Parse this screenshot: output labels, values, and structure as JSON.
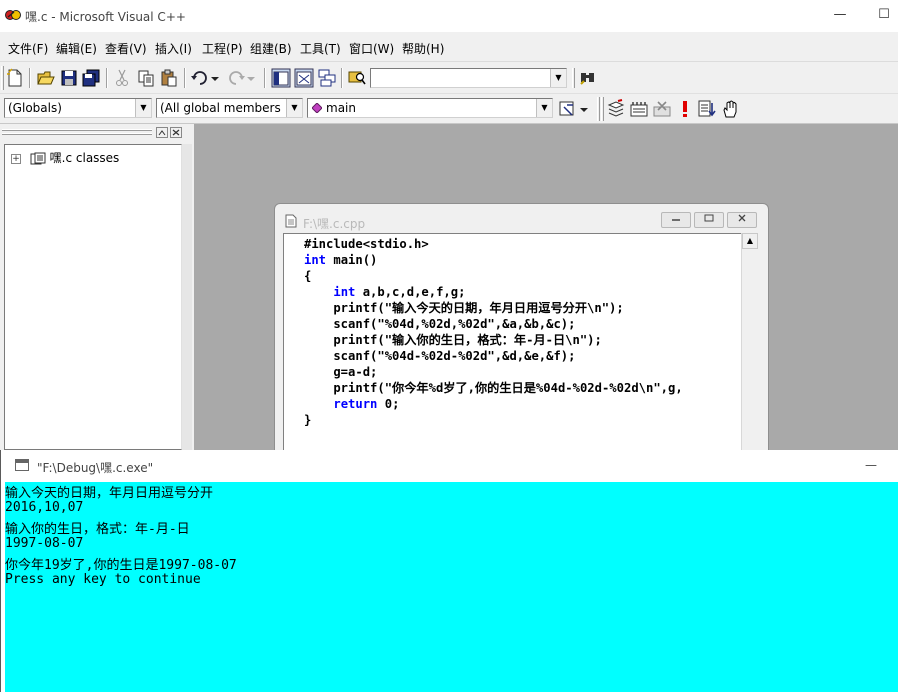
{
  "window": {
    "title": "嘿.c - Microsoft Visual C++",
    "minimize_glyph": "—",
    "maximize_glyph": "☐"
  },
  "menu": [
    "文件(F)",
    "编辑(E)",
    "查看(V)",
    "插入(I)",
    "工程(P)",
    "组建(B)",
    "工具(T)",
    "窗口(W)",
    "帮助(H)"
  ],
  "toolbar1": {
    "find_value": ""
  },
  "toolbar2": {
    "globals_combo": "(Globals)",
    "members_combo": "(All global members",
    "function_combo": "main",
    "function_icon_color": "#c040c0"
  },
  "workspace": {
    "tree_root": "嘿.c classes",
    "expand_glyph": "+"
  },
  "editor": {
    "title": "F:\\嘿.c.cpp",
    "code_lines": [
      {
        "pre": "#include<stdio.h>",
        "kw": "",
        "post": ""
      },
      {
        "pre": "",
        "kw": "int",
        "post": " main()"
      },
      {
        "pre": "{",
        "kw": "",
        "post": ""
      },
      {
        "pre": "    ",
        "kw": "int",
        "post": " a,b,c,d,e,f,g;"
      },
      {
        "pre": "    printf(\"输入今天的日期，年月日用逗号分开\\n\");",
        "kw": "",
        "post": ""
      },
      {
        "pre": "    scanf(\"%04d,%02d,%02d\",&a,&b,&c);",
        "kw": "",
        "post": ""
      },
      {
        "pre": "    printf(\"输入你的生日，格式：年-月-日\\n\");",
        "kw": "",
        "post": ""
      },
      {
        "pre": "    scanf(\"%04d-%02d-%02d\",&d,&e,&f);",
        "kw": "",
        "post": ""
      },
      {
        "pre": "    g=a-d;",
        "kw": "",
        "post": ""
      },
      {
        "pre": "    printf(\"你今年%d岁了,你的生日是%04d-%02d-%02d\\n\",g,",
        "kw": "",
        "post": ""
      },
      {
        "pre": "    ",
        "kw": "return",
        "post": " 0;"
      },
      {
        "pre": "}",
        "kw": "",
        "post": ""
      }
    ]
  },
  "console": {
    "title": "\"F:\\Debug\\嘿.c.exe\"",
    "background": "#00ffff",
    "lines": [
      "输入今天的日期，年月日用逗号分开",
      "2016,10,07",
      "输入你的生日，格式：年-月-日",
      "1997-08-07",
      "你今年19岁了,你的生日是1997-08-07",
      "Press any key to continue"
    ]
  },
  "colors": {
    "mdi_background": "#a9a9a9",
    "keyword": "#0000ff"
  }
}
